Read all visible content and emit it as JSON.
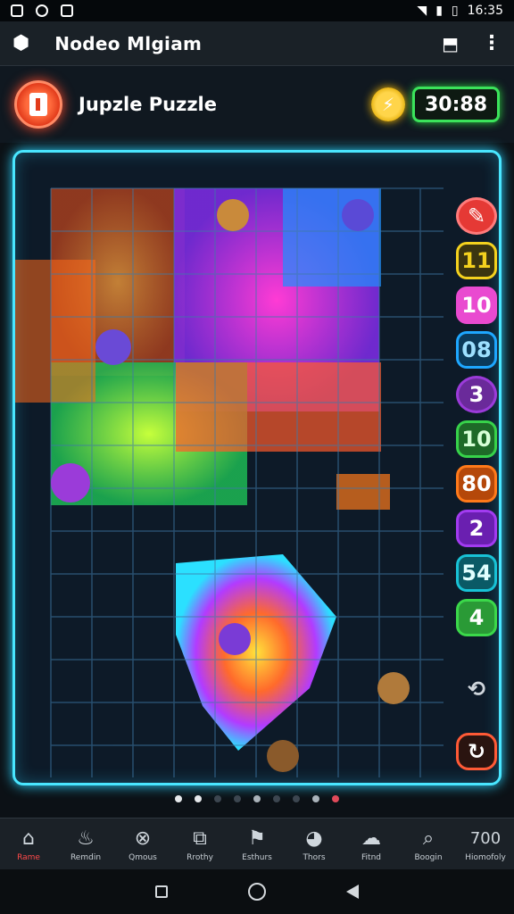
{
  "status_bar": {
    "time": "16:35"
  },
  "app_bar": {
    "title": "Nodeo Mlgiam"
  },
  "header": {
    "game_title": "Jupzle Puzzle",
    "timer": "30:88"
  },
  "side_buttons": [
    {
      "label": "",
      "icon": "pencil-slash-icon",
      "color": "#e53935"
    },
    {
      "label": "11",
      "color": "#f4d21e"
    },
    {
      "label": "10",
      "color": "#e94ad0"
    },
    {
      "label": "08",
      "color": "#1ea7ff"
    },
    {
      "label": "3",
      "color": "#9b3bd9"
    },
    {
      "label": "10",
      "color": "#37d24a"
    },
    {
      "label": "80",
      "color": "#ff7a1a"
    },
    {
      "label": "2",
      "color": "#a23bf0"
    },
    {
      "label": "54",
      "color": "#18c2d6"
    },
    {
      "label": "4",
      "color": "#3bd84a"
    },
    {
      "label": "",
      "icon": "shuffle-icon",
      "color": "#cfd6dc"
    },
    {
      "label": "",
      "icon": "rotate-icon",
      "color": "#ff5a36"
    }
  ],
  "pagination": {
    "count": 9,
    "active_index": 0,
    "accent_index": 8
  },
  "bottom_nav": [
    {
      "label": "Rame",
      "icon": "home-icon",
      "active": true
    },
    {
      "label": "Remdin",
      "icon": "flame-icon"
    },
    {
      "label": "Qmous",
      "icon": "compass-icon"
    },
    {
      "label": "Rrothy",
      "icon": "puzzle-icon"
    },
    {
      "label": "Esthurs",
      "icon": "flag-icon"
    },
    {
      "label": "Thors",
      "icon": "chat-icon"
    },
    {
      "label": "Fitnd",
      "icon": "bubble-icon"
    },
    {
      "label": "Boogin",
      "icon": "search-icon"
    },
    {
      "label": "Hiomofoly",
      "icon": "score-icon",
      "value": "700"
    }
  ],
  "colors": {
    "accent_cyan": "#49e6ff",
    "timer_green": "#3be35b",
    "home_active": "#ff4a4a"
  }
}
